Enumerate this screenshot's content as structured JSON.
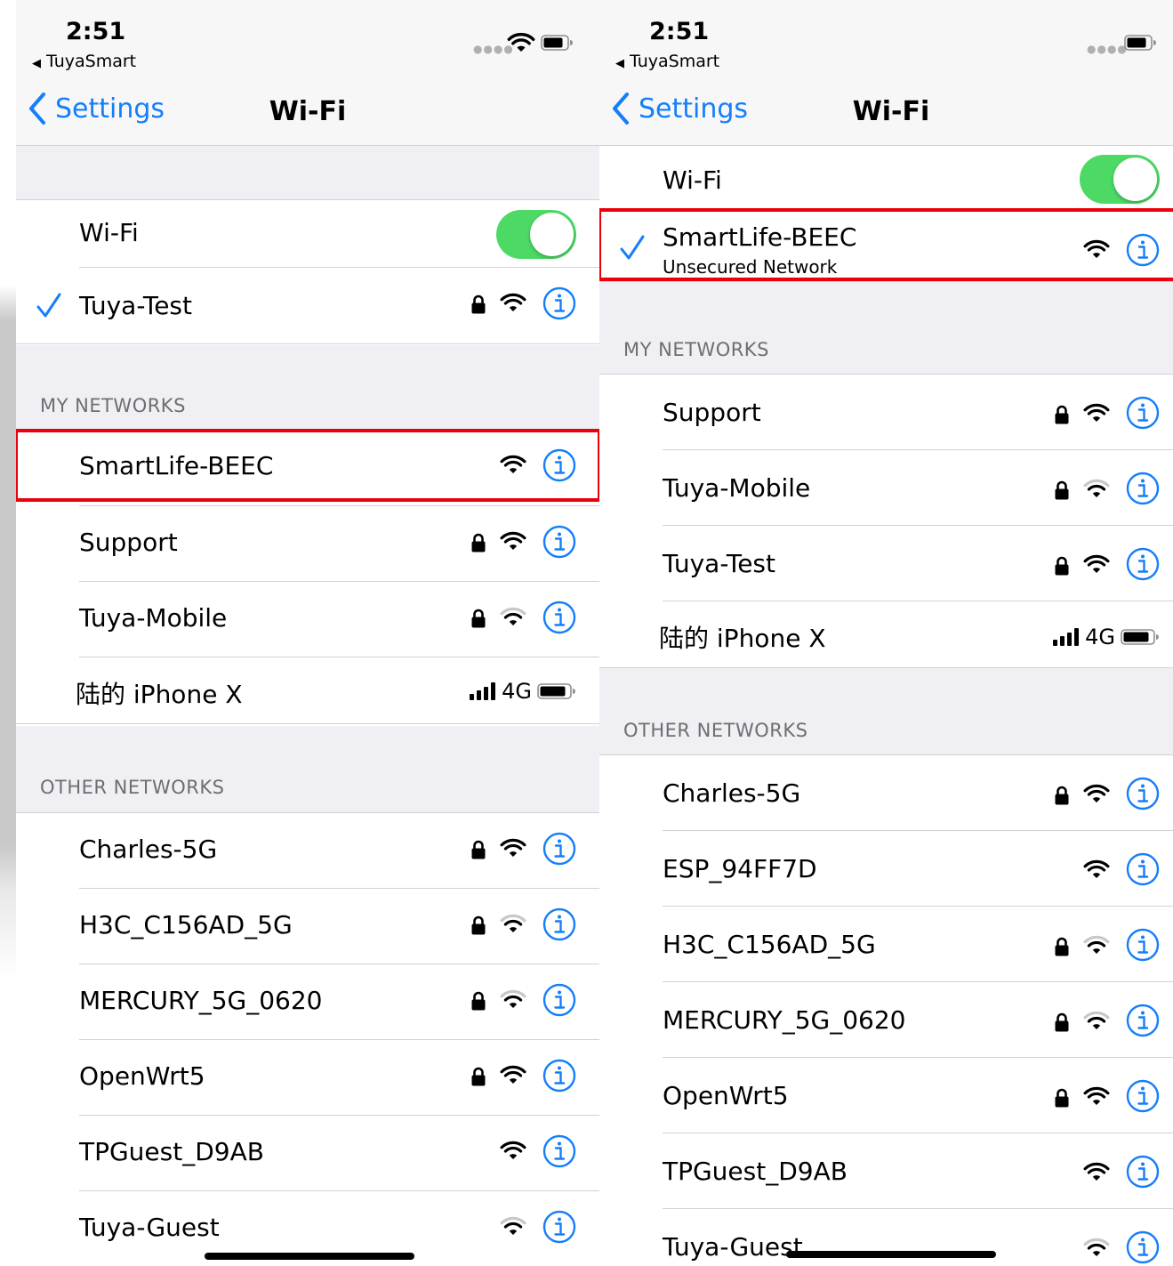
{
  "colors": {
    "accent": "#157efb",
    "toggle_on": "#4cd964",
    "highlight": "#e8000a",
    "group_bg": "#efeff4"
  },
  "left": {
    "status": {
      "time": "2:51",
      "back_app": "TuyaSmart"
    },
    "nav": {
      "back_label": "Settings",
      "title": "Wi-Fi"
    },
    "wifi_label": "Wi-Fi",
    "wifi_enabled": true,
    "current": {
      "name": "Tuya-Test",
      "secured": true,
      "signal": 3
    },
    "my_networks_header": "MY NETWORKS",
    "my_networks": [
      {
        "name": "SmartLife-BEEC",
        "secured": false,
        "signal": 3,
        "highlighted": true
      },
      {
        "name": "Support",
        "secured": true,
        "signal": 3
      },
      {
        "name": "Tuya-Mobile",
        "secured": true,
        "signal": 2
      },
      {
        "name": "陆的 iPhone X",
        "hotspot": true,
        "network_type": "4G"
      }
    ],
    "other_networks_header": "OTHER NETWORKS",
    "other_networks": [
      {
        "name": "Charles-5G",
        "secured": true,
        "signal": 3
      },
      {
        "name": "H3C_C156AD_5G",
        "secured": true,
        "signal": 2
      },
      {
        "name": "MERCURY_5G_0620",
        "secured": true,
        "signal": 2
      },
      {
        "name": "OpenWrt5",
        "secured": true,
        "signal": 3
      },
      {
        "name": "TPGuest_D9AB",
        "secured": false,
        "signal": 3
      },
      {
        "name": "Tuya-Guest",
        "secured": false,
        "signal": 2
      }
    ]
  },
  "right": {
    "status": {
      "time": "2:51",
      "back_app": "TuyaSmart"
    },
    "nav": {
      "back_label": "Settings",
      "title": "Wi-Fi"
    },
    "wifi_label": "Wi-Fi",
    "wifi_enabled": true,
    "current": {
      "name": "SmartLife-BEEC",
      "subtitle": "Unsecured Network",
      "secured": false,
      "signal": 3,
      "highlighted": true
    },
    "my_networks_header": "MY NETWORKS",
    "my_networks": [
      {
        "name": "Support",
        "secured": true,
        "signal": 3
      },
      {
        "name": "Tuya-Mobile",
        "secured": true,
        "signal": 2
      },
      {
        "name": "Tuya-Test",
        "secured": true,
        "signal": 3
      },
      {
        "name": "陆的 iPhone X",
        "hotspot": true,
        "network_type": "4G"
      }
    ],
    "other_networks_header": "OTHER NETWORKS",
    "other_networks": [
      {
        "name": "Charles-5G",
        "secured": true,
        "signal": 3
      },
      {
        "name": "ESP_94FF7D",
        "secured": false,
        "signal": 3
      },
      {
        "name": "H3C_C156AD_5G",
        "secured": true,
        "signal": 2
      },
      {
        "name": "MERCURY_5G_0620",
        "secured": true,
        "signal": 2
      },
      {
        "name": "OpenWrt5",
        "secured": true,
        "signal": 3
      },
      {
        "name": "TPGuest_D9AB",
        "secured": false,
        "signal": 3
      },
      {
        "name": "Tuya-Guest",
        "secured": false,
        "signal": 2
      }
    ]
  }
}
